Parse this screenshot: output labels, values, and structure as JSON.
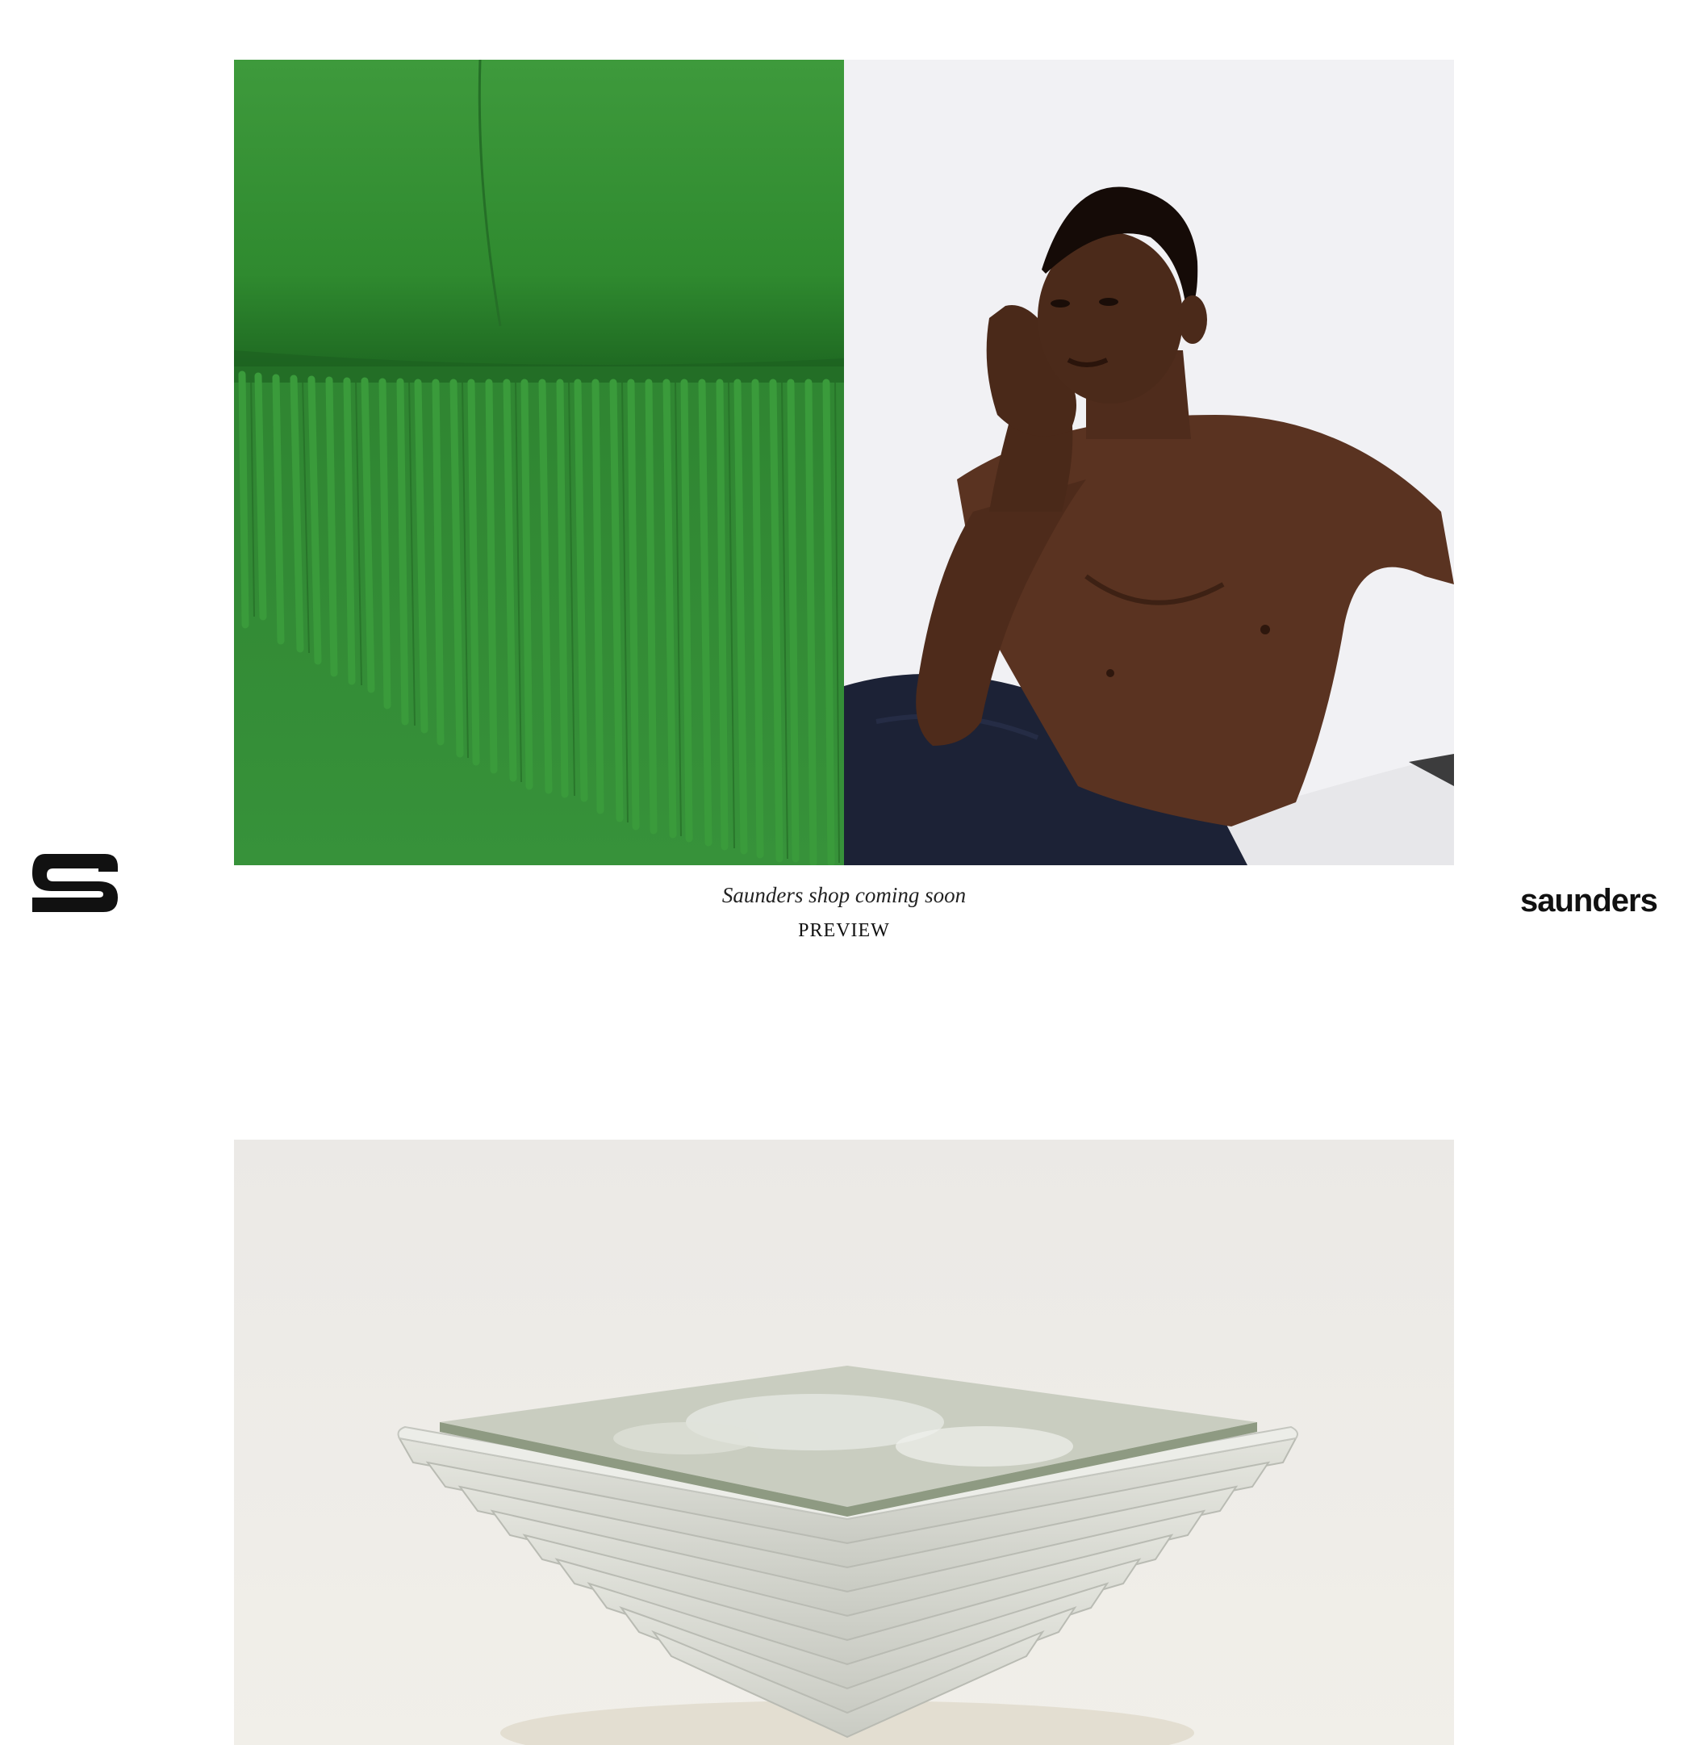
{
  "brand": {
    "wordmark": "saunders",
    "mark_icon": "saunders-s-logo-icon"
  },
  "hero": {
    "left_image": "green-fringe-sofa-image",
    "right_image": "model-reclining-portrait-image"
  },
  "caption": {
    "title": "Saunders shop coming soon",
    "link_label": "PREVIEW"
  },
  "product": {
    "image": "stepped-marble-coffee-table-image"
  },
  "colors": {
    "background": "#ffffff",
    "text": "#111111",
    "green": "#2f8a33",
    "navy": "#1c2236",
    "skin": "#4a2a1a"
  }
}
